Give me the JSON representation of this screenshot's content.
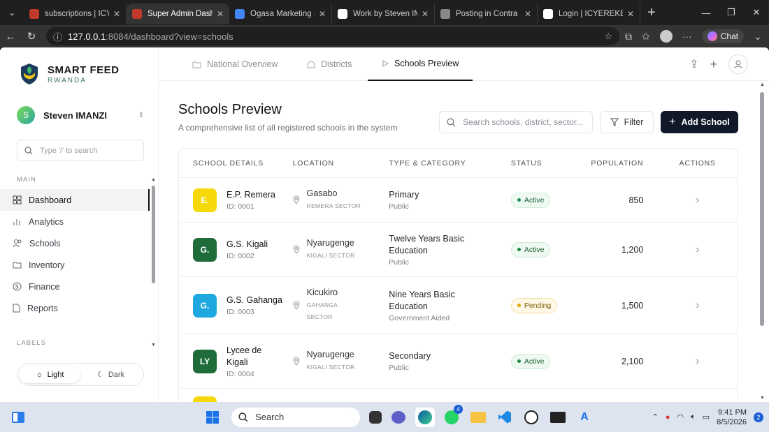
{
  "browser": {
    "tabs": [
      {
        "title": "subscriptions | ICYEREKEZO",
        "favicon_color": "#c0392b",
        "active": false
      },
      {
        "title": "Super Admin Dashboard",
        "favicon_color": "#c0392b",
        "active": true
      },
      {
        "title": "Ogasa Marketing Strategy",
        "favicon_color": "#4285f4",
        "active": false
      },
      {
        "title": "Work by Steven IMANZI",
        "favicon_color": "#ffffff",
        "active": false
      },
      {
        "title": "Posting in Contra Portfolio",
        "favicon_color": "#888888",
        "active": false
      },
      {
        "title": "Login | ICYEREKEZO",
        "favicon_color": "#ffffff",
        "active": false
      }
    ],
    "url_host": "127.0.0.1",
    "url_rest": ":8084/dashboard?view=schools",
    "chat_label": "Chat"
  },
  "brand": {
    "name": "SMART FEED",
    "sub": "RWANDA",
    "color": "#3b7a57"
  },
  "user": {
    "initial": "S",
    "name": "Steven IMANZI"
  },
  "sidebar": {
    "search_placeholder": "Type '/' to search",
    "main_label": "MAIN",
    "labels_label": "LABELS",
    "items": [
      {
        "label": "Dashboard",
        "icon": "grid-icon",
        "active": true
      },
      {
        "label": "Analytics",
        "icon": "bar-chart-icon",
        "active": false
      },
      {
        "label": "Schools",
        "icon": "users-icon",
        "active": false
      },
      {
        "label": "Inventory",
        "icon": "folder-icon",
        "active": false
      },
      {
        "label": "Finance",
        "icon": "dollar-icon",
        "active": false
      },
      {
        "label": "Reports",
        "icon": "file-icon",
        "active": false
      }
    ],
    "theme": {
      "light": "Light",
      "dark": "Dark"
    }
  },
  "topnav": {
    "tabs": [
      {
        "label": "National Overview",
        "icon": "folder-icon"
      },
      {
        "label": "Districts",
        "icon": "building-icon"
      },
      {
        "label": "Schools Preview",
        "icon": "play-icon"
      }
    ]
  },
  "page": {
    "title": "Schools Preview",
    "subtitle": "A comprehensive list of all registered schools in the system",
    "search_placeholder": "Search schools, district, sector...",
    "filter_label": "Filter",
    "add_label": "Add School"
  },
  "table": {
    "headers": [
      "SCHOOL DETAILS",
      "LOCATION",
      "TYPE & CATEGORY",
      "STATUS",
      "POPULATION",
      "ACTIONS"
    ],
    "rows": [
      {
        "initials": "E.",
        "color": "#f5d90a",
        "name": "E.P. Remera",
        "id": "ID: 0001",
        "district": "Gasabo",
        "sector": "REMERA SECTOR",
        "type": "Primary",
        "category": "Public",
        "status": "Active",
        "population": "850"
      },
      {
        "initials": "G.",
        "color": "#1f6b3a",
        "name": "G.S. Kigali",
        "id": "ID: 0002",
        "district": "Nyarugenge",
        "sector": "KIGALI SECTOR",
        "type": "Twelve Years Basic Education",
        "category": "Public",
        "status": "Active",
        "population": "1,200"
      },
      {
        "initials": "G.",
        "color": "#1ea8e0",
        "name": "G.S. Gahanga",
        "id": "ID: 0003",
        "district": "Kicukiro",
        "sector": "GAHANGA SECTOR",
        "type": "Nine Years Basic Education",
        "category": "Government Aided",
        "status": "Pending",
        "population": "1,500"
      },
      {
        "initials": "LY",
        "color": "#1f6b3a",
        "name": "Lycee de Kigali",
        "id": "ID: 0004",
        "district": "Nyarugenge",
        "sector": "KIGALI SECTOR",
        "type": "Secondary",
        "category": "Public",
        "status": "Active",
        "population": "2,100"
      },
      {
        "initials": "",
        "color": "#f5d90a",
        "name": "",
        "id": "",
        "district": "",
        "sector": "",
        "type": "",
        "category": "",
        "status": "",
        "population": ""
      }
    ]
  },
  "taskbar": {
    "search_label": "Search",
    "time": "9:41 PM",
    "date": "8/5/2026",
    "notifications": "2",
    "whatsapp_badge": "4"
  }
}
